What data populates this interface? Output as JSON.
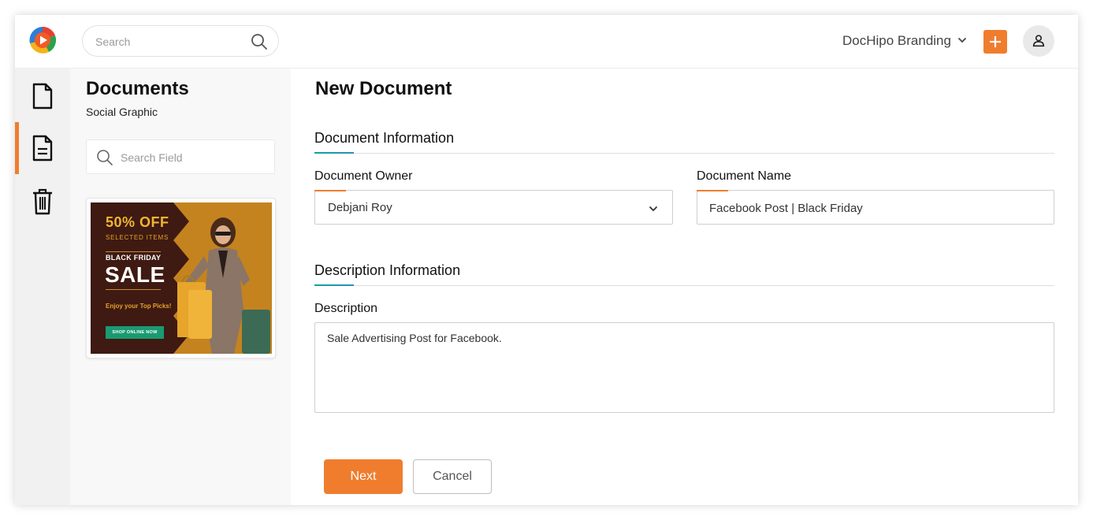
{
  "colors": {
    "accent": "#f07d2e",
    "teal": "#0fa39a",
    "rail_bg": "#f1f1f1",
    "panel_bg": "#f8f8f8"
  },
  "header": {
    "search_placeholder": "Search",
    "workspace": "DocHipo Branding",
    "icons": [
      "dochipo-logo-icon",
      "search-icon",
      "chevron-down-icon",
      "plus-icon",
      "user-icon"
    ]
  },
  "rail": {
    "items": [
      {
        "icon": "document-icon",
        "active": false
      },
      {
        "icon": "document-lines-icon",
        "active": true
      },
      {
        "icon": "trash-icon",
        "active": false
      }
    ]
  },
  "panel": {
    "title": "Documents",
    "subtitle": "Social Graphic",
    "search_placeholder": "Search Field",
    "thumbnail": {
      "headline": "50% OFF",
      "subline": "SELECTED ITEMS",
      "tag": "BLACK FRIDAY",
      "big": "SALE",
      "tagline": "Enjoy your Top Picks!",
      "cta": "SHOP ONLINE NOW"
    }
  },
  "form": {
    "title": "New Document",
    "section1": "Document Information",
    "owner_label": "Document Owner",
    "owner_value": "Debjani Roy",
    "name_label": "Document Name",
    "name_value": "Facebook Post | Black Friday",
    "section2": "Description Information",
    "description_label": "Description",
    "description_value": "Sale Advertising Post for Facebook.",
    "next_label": "Next",
    "cancel_label": "Cancel"
  }
}
